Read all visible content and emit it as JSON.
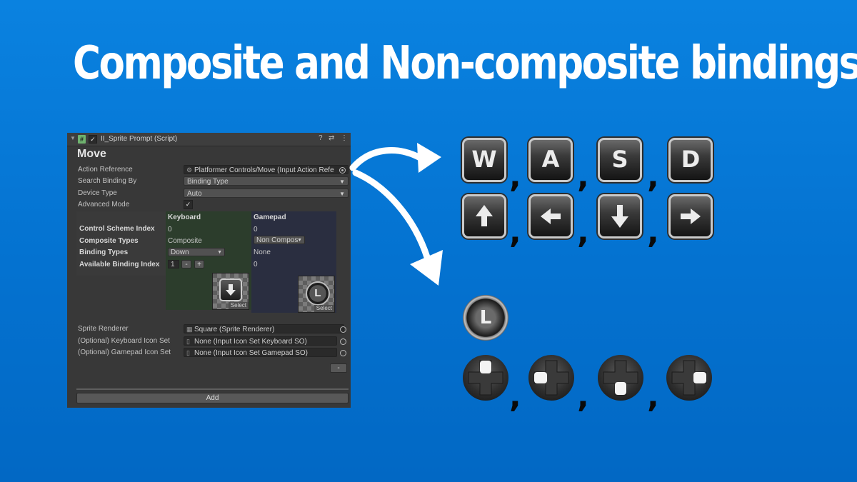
{
  "headline": "Composite and Non-composite bindings",
  "inspector": {
    "component_title": "II_Sprite Prompt (Script)",
    "section_title": "Move",
    "rows": {
      "action_reference": {
        "label": "Action Reference",
        "value": "Platformer Controls/Move (Input Action Refe"
      },
      "search_binding_by": {
        "label": "Search Binding By",
        "value": "Binding Type"
      },
      "device_type": {
        "label": "Device Type",
        "value": "Auto"
      },
      "advanced_mode": {
        "label": "Advanced Mode",
        "checked": "✓"
      }
    },
    "grid": {
      "headers": {
        "keyboard": "Keyboard",
        "gamepad": "Gamepad"
      },
      "labels": {
        "control_scheme_index": "Control Scheme Index",
        "composite_types": "Composite Types",
        "binding_types": "Binding Types",
        "available_binding_index": "Available Binding Index"
      },
      "keyboard": {
        "control_scheme_index": "0",
        "composite_types": "Composite",
        "binding_types": "Down",
        "available_binding_index": "1",
        "decrement": "-",
        "increment": "+",
        "select": "Select"
      },
      "gamepad": {
        "control_scheme_index": "0",
        "composite_types": "Non Compos",
        "binding_types": "None",
        "available_binding_index": "0",
        "select": "Select",
        "sprite_letter": "L"
      }
    },
    "sprite_renderer": {
      "label": "Sprite Renderer",
      "value": "Square (Sprite Renderer)"
    },
    "keyboard_icon_set": {
      "label": "(Optional) Keyboard Icon Set",
      "value": "None (Input Icon Set Keyboard SO)"
    },
    "gamepad_icon_set": {
      "label": "(Optional) Gamepad Icon Set",
      "value": "None (Input Icon Set Gamepad SO)"
    },
    "remove_label": "-",
    "add_label": "Add"
  },
  "keys_row1": [
    "W",
    "A",
    "S",
    "D"
  ],
  "arrow_keys": [
    "up",
    "left",
    "down",
    "right"
  ],
  "separator": ",",
  "gamepad_button": "L",
  "dpad_directions": [
    "up",
    "left",
    "down",
    "right"
  ],
  "colors": {
    "background": "#0472d0",
    "panel": "#383838",
    "keyboard_panel": "#2c3d2c",
    "gamepad_panel": "#2a2e40"
  }
}
